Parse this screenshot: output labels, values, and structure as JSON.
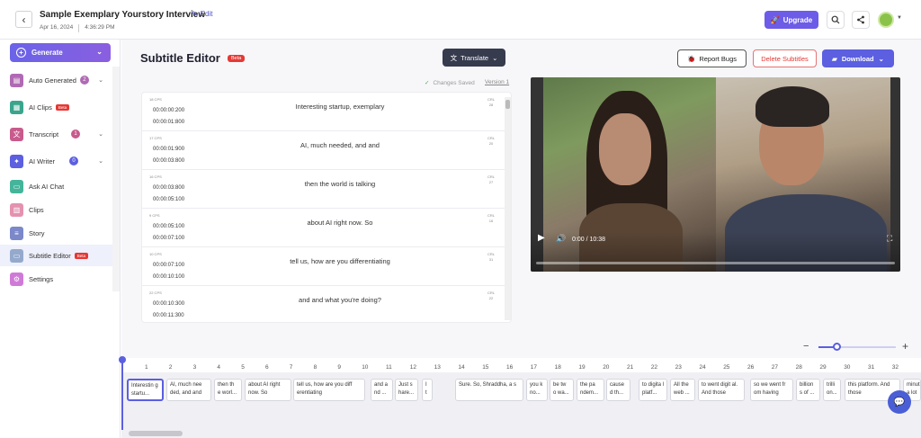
{
  "header": {
    "title": "Sample Exemplary Yourstory Interview",
    "edit_label": "Edit",
    "date": "Apr 16, 2024",
    "time": "4:36:29 PM",
    "upgrade_label": "Upgrade"
  },
  "sidebar": {
    "generate_label": "Generate",
    "items": [
      {
        "label": "Auto Generated",
        "count": "2",
        "color": "#b06ab3",
        "icon": "auto-generated-icon"
      },
      {
        "label": "AI Clips",
        "beta": "Beta",
        "color": "#3aa58c",
        "icon": "ai-clips-icon"
      },
      {
        "label": "Transcript",
        "count": "1",
        "color": "#c85a8c",
        "icon": "transcript-icon"
      },
      {
        "label": "AI Writer",
        "count": "0",
        "color": "#5b5fe0",
        "icon": "ai-writer-icon"
      },
      {
        "label": "Ask AI Chat",
        "color": "#44b59a",
        "icon": "chat-icon"
      },
      {
        "label": "Clips",
        "color": "#e591b0",
        "icon": "clips-icon"
      },
      {
        "label": "Story",
        "color": "#7b88c9",
        "icon": "story-icon"
      },
      {
        "label": "Subtitle Editor",
        "beta": "Beta",
        "color": "#94a9cc",
        "icon": "subtitle-icon"
      },
      {
        "label": "Settings",
        "color": "#d07ad8",
        "icon": "settings-icon"
      }
    ]
  },
  "editor": {
    "title": "Subtitle Editor",
    "beta": "Beta",
    "translate_label": "Translate",
    "report_label": "Report Bugs",
    "delete_label": "Delete Subtitles",
    "download_label": "Download",
    "saved_label": "Changes Saved",
    "version_label": "Version 1"
  },
  "subtitles": [
    {
      "cps": "18 CPS",
      "start": "00:00:00:200",
      "end": "00:00:01:800",
      "text": "Interesting startup, exemplary",
      "crl_label": "CRL",
      "crl": "28"
    },
    {
      "cps": "17 CPS",
      "start": "00:00:01:900",
      "end": "00:00:03:800",
      "text": "AI, much needed, and and",
      "crl_label": "CRL",
      "crl": "20"
    },
    {
      "cps": "16 CPS",
      "start": "00:00:03:800",
      "end": "00:00:05:100",
      "text": "then the world is talking",
      "crl_label": "CRL",
      "crl": "27"
    },
    {
      "cps": "9 CPS",
      "start": "00:00:05:100",
      "end": "00:00:07:100",
      "text": "about AI right now. So",
      "crl_label": "CRL",
      "crl": "16"
    },
    {
      "cps": "10 CPS",
      "start": "00:00:07:100",
      "end": "00:00:10:100",
      "text": "tell us, how are you differentiating",
      "crl_label": "CRL",
      "crl": "31"
    },
    {
      "cps": "22 CPS",
      "start": "00:00:10:300",
      "end": "00:00:11:300",
      "text": "and and what you're doing?",
      "crl_label": "CRL",
      "crl": "22"
    }
  ],
  "video": {
    "time": "0:00 / 10:38"
  },
  "timeline": {
    "ticks": [
      "1",
      "2",
      "3",
      "4",
      "5",
      "6",
      "7",
      "8",
      "9",
      "10",
      "11",
      "12",
      "13",
      "14",
      "15",
      "16",
      "17",
      "18",
      "19",
      "20",
      "21",
      "22",
      "23",
      "24",
      "25",
      "26",
      "27",
      "28",
      "29",
      "30",
      "31",
      "32"
    ],
    "clips": [
      {
        "text": "Interestin g startu..."
      },
      {
        "text": "AI, much nee ded, and and"
      },
      {
        "text": "then th e worl..."
      },
      {
        "text": "about AI right now. So"
      },
      {
        "text": "tell us, how are you diff erentiating"
      },
      {
        "text": "and a nd ..."
      },
      {
        "text": "Just s hare..."
      },
      {
        "text": "I t"
      },
      {
        "text": "Sure. So, Shraddha, a s"
      },
      {
        "text": "you k no..."
      },
      {
        "text": "be tw o wa..."
      },
      {
        "text": "the pa ndem..."
      },
      {
        "text": "cause d th..."
      },
      {
        "text": "to digita l platf..."
      },
      {
        "text": "All the web ..."
      },
      {
        "text": "to went digit al. And those"
      },
      {
        "text": "so we went fr om having"
      },
      {
        "text": "billion s of ..."
      },
      {
        "text": "trilli on..."
      },
      {
        "text": "this platform. And those"
      },
      {
        "text": "minut a lot"
      }
    ]
  },
  "colors": {
    "accent": "#5b5fe0",
    "danger": "#e53935"
  }
}
